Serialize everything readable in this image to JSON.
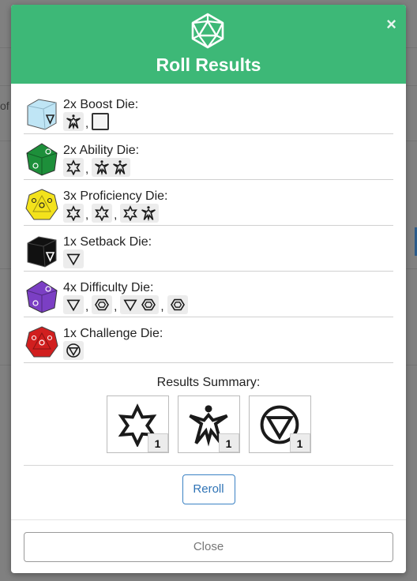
{
  "modal": {
    "title": "Roll Results",
    "close_glyph": "×",
    "header_icon": "d20-icon",
    "header_color": "#3db877"
  },
  "dice": [
    {
      "label": "2x Boost Die:",
      "die_icon": "boost-die-icon",
      "color": "#bfe5f5",
      "results": [
        [
          "advantage"
        ],
        [
          "blank"
        ]
      ]
    },
    {
      "label": "2x Ability Die:",
      "die_icon": "ability-die-icon",
      "color": "#1d8f3a",
      "results": [
        [
          "success"
        ],
        [
          "advantage",
          "advantage"
        ]
      ]
    },
    {
      "label": "3x Proficiency Die:",
      "die_icon": "proficiency-die-icon",
      "color": "#f3e21c",
      "results": [
        [
          "success"
        ],
        [
          "success"
        ],
        [
          "success",
          "advantage"
        ]
      ]
    },
    {
      "label": "1x Setback Die:",
      "die_icon": "setback-die-icon",
      "color": "#111111",
      "results": [
        [
          "failure"
        ]
      ]
    },
    {
      "label": "4x Difficulty Die:",
      "die_icon": "difficulty-die-icon",
      "color": "#7b3fc4",
      "results": [
        [
          "failure"
        ],
        [
          "threat"
        ],
        [
          "failure",
          "threat"
        ],
        [
          "threat"
        ]
      ]
    },
    {
      "label": "1x Challenge Die:",
      "die_icon": "challenge-die-icon",
      "color": "#d11f1f",
      "results": [
        [
          "despair"
        ]
      ]
    }
  ],
  "separator": ",",
  "summary": {
    "title": "Results Summary:",
    "items": [
      {
        "icon": "success-icon",
        "count": "1"
      },
      {
        "icon": "advantage-icon",
        "count": "1"
      },
      {
        "icon": "despair-icon",
        "count": "1"
      }
    ]
  },
  "buttons": {
    "reroll": "Reroll",
    "close": "Close"
  },
  "background": {
    "fragment": "of"
  }
}
